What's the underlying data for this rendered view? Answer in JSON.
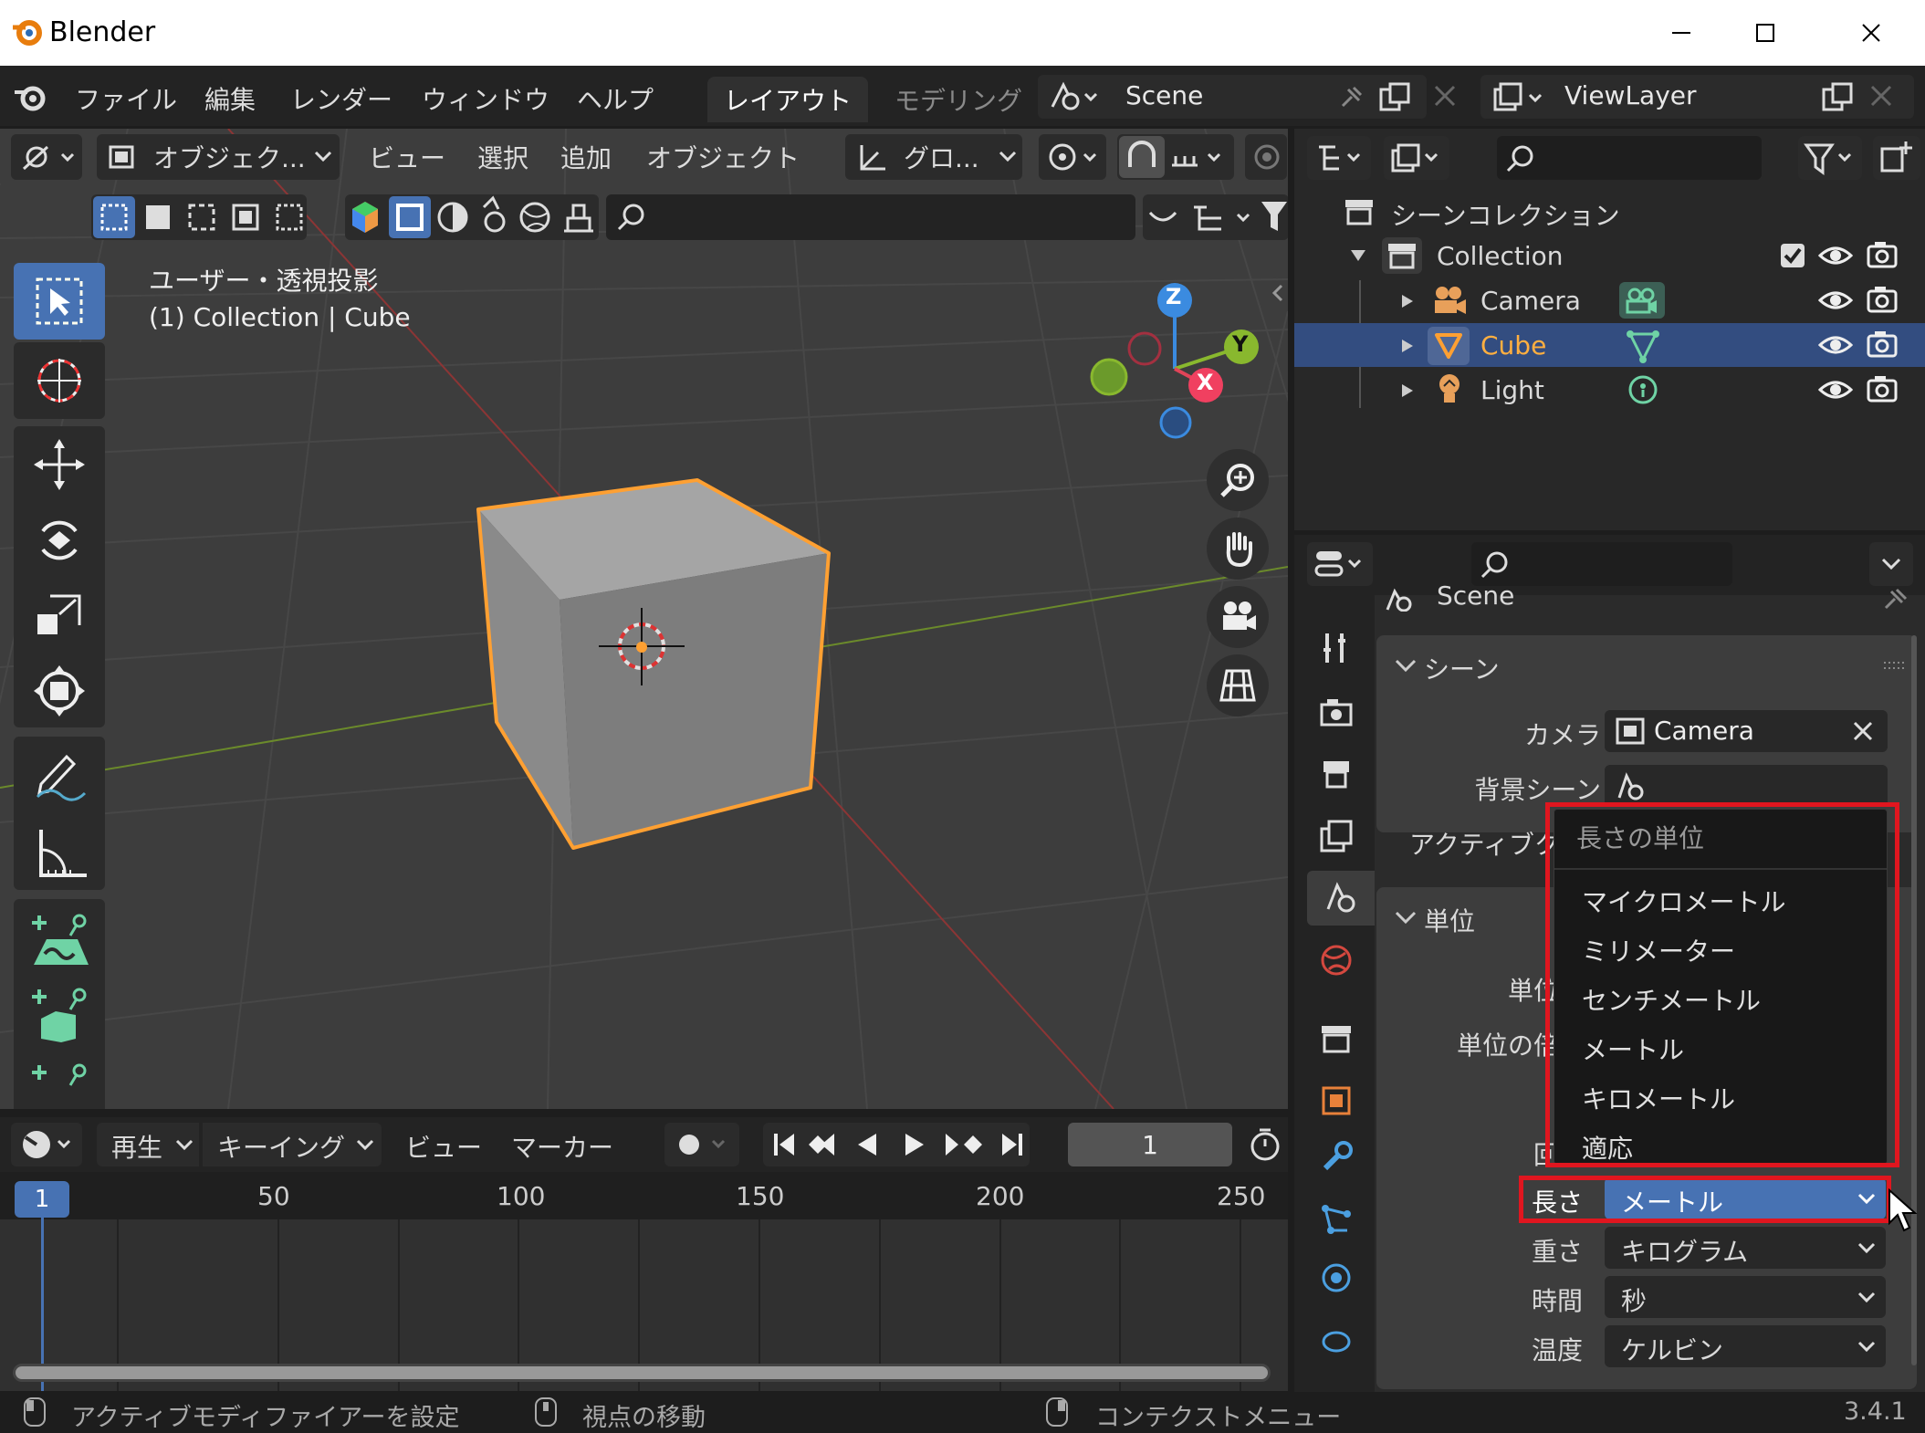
{
  "app": {
    "title": "Blender",
    "version": "3.4.1"
  },
  "menubar": {
    "items": [
      "ファイル",
      "編集",
      "レンダー",
      "ウィンドウ",
      "ヘルプ"
    ]
  },
  "workspaces": {
    "active": "レイアウト",
    "next": "モデリング"
  },
  "scene": {
    "name": "Scene"
  },
  "view_layer": {
    "name": "ViewLayer"
  },
  "viewport": {
    "mode": "オブジェク...",
    "menus": [
      "ビュー",
      "選択",
      "追加",
      "オブジェクト"
    ],
    "transform_orientation": "グロ...",
    "overlay_title": "ユーザー・透視投影",
    "overlay_subtitle": "(1) Collection | Cube",
    "gizmo": {
      "z": "Z",
      "y": "Y",
      "x": "X"
    }
  },
  "outliner": {
    "root": "シーンコレクション",
    "collection": "Collection",
    "items": [
      {
        "name": "Camera",
        "selected": false
      },
      {
        "name": "Cube",
        "selected": true
      },
      {
        "name": "Light",
        "selected": false
      }
    ]
  },
  "properties": {
    "scene_header": "Scene",
    "panel_scene": "シーン",
    "camera_label": "カメラ",
    "camera_value": "Camera",
    "bg_scene_label": "背景シーン",
    "active_clip_label": "アクティブク",
    "panel_units": "単位",
    "unit_system_label": "単位",
    "unit_scale_label": "単位の倍",
    "rotation_label_partial": "回",
    "length_label": "長さ",
    "length_value": "メートル",
    "mass_label": "重さ",
    "mass_value": "キログラム",
    "time_label": "時間",
    "time_value": "秒",
    "temperature_label": "温度",
    "temperature_value": "ケルビン"
  },
  "length_dropdown": {
    "header": "長さの単位",
    "options": [
      "マイクロメートル",
      "ミリメーター",
      "センチメートル",
      "メートル",
      "キロメートル",
      "適応"
    ]
  },
  "timeline": {
    "menus": [
      "再生",
      "キーイング",
      "ビュー",
      "マーカー"
    ],
    "current_frame": "1",
    "ruler": [
      "50",
      "100",
      "150",
      "200",
      "250"
    ],
    "playhead_label": "1"
  },
  "statusbar": {
    "left": "アクティブモディファイアーを設定",
    "middle": "視点の移動",
    "right": "コンテクストメニュー"
  },
  "colors": {
    "accent_blue": "#4772b3",
    "selection_orange": "#ffa032",
    "highlight_red": "#e0161f",
    "outliner_selected": "#334d80"
  }
}
